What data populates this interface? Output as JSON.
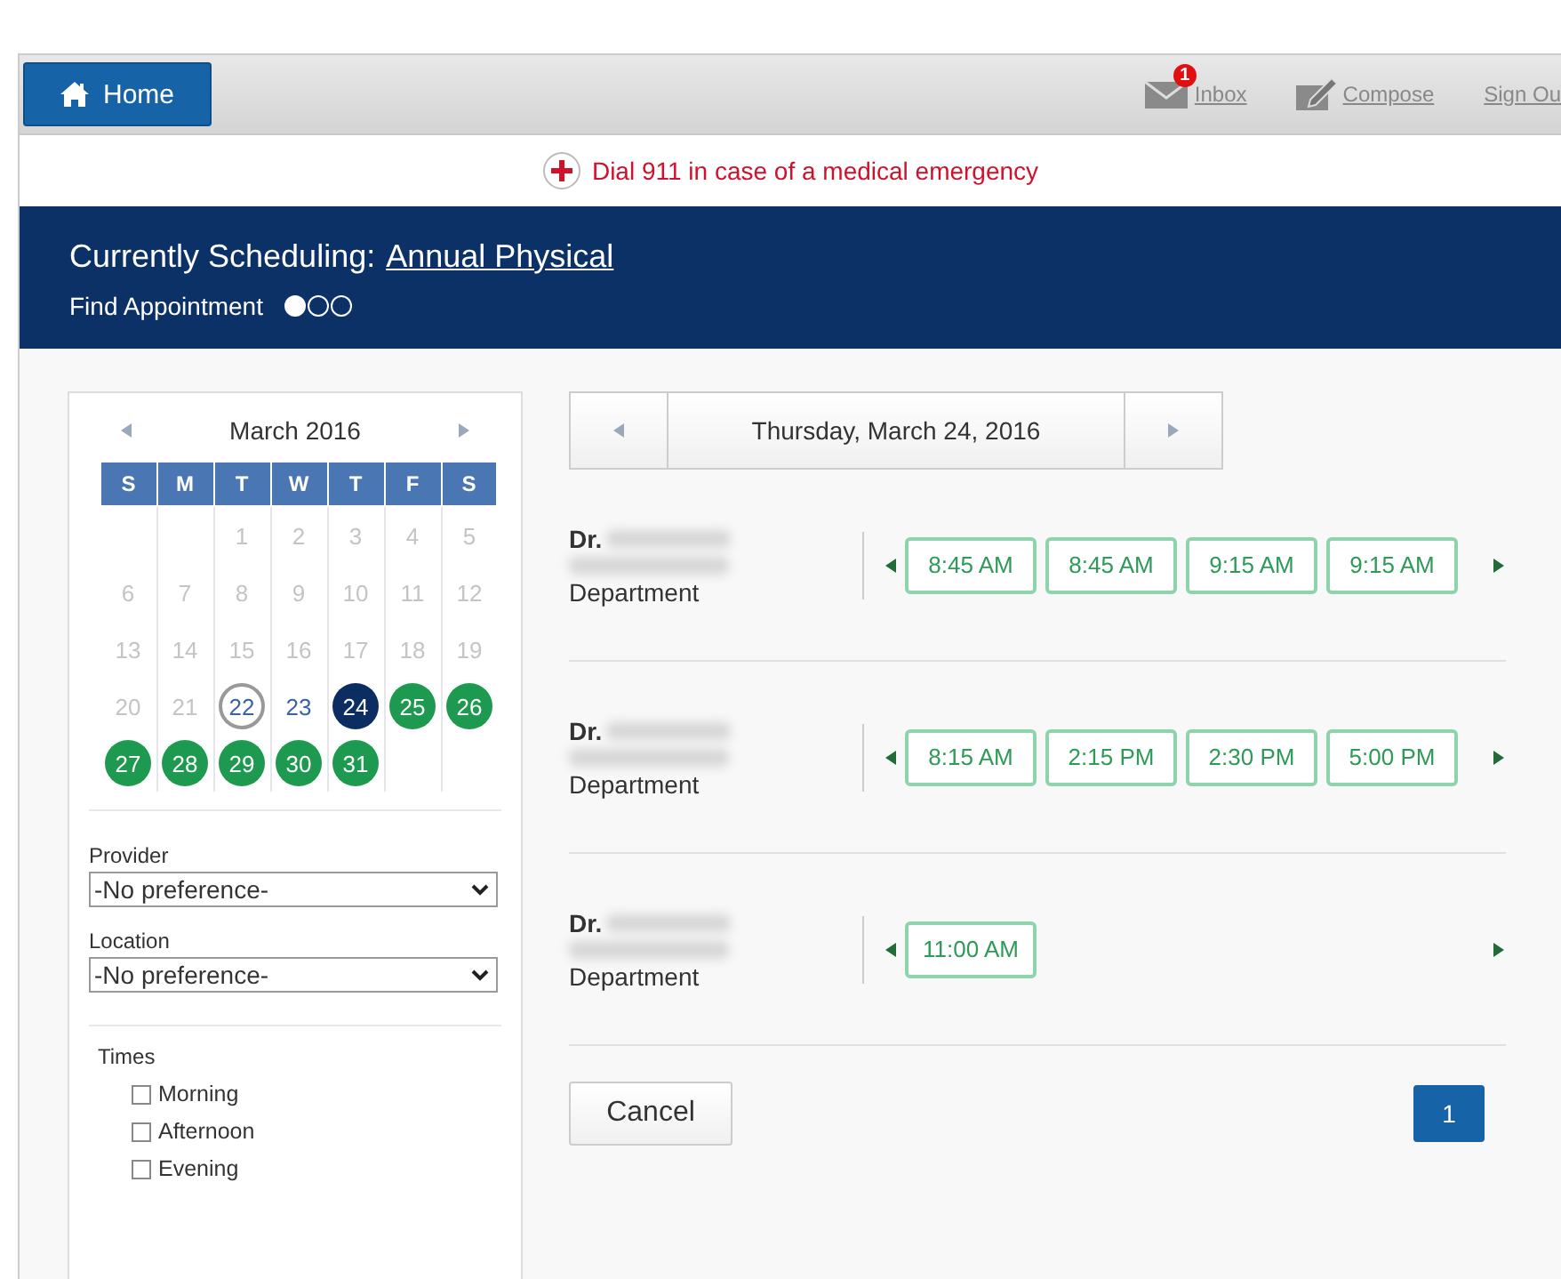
{
  "topbar": {
    "home": "Home",
    "inbox": {
      "label": "Inbox",
      "badge": "1"
    },
    "compose": "Compose",
    "sign_out": "Sign Ou"
  },
  "alert": "Dial 911 in case of a medical emergency",
  "banner": {
    "label": "Currently Scheduling:",
    "link": "Annual Physical",
    "step_label": "Find Appointment",
    "steps": [
      {
        "selected": true
      },
      {
        "selected": false
      },
      {
        "selected": false
      }
    ]
  },
  "calendar": {
    "month": "March 2016",
    "weekdays": [
      "S",
      "M",
      "T",
      "W",
      "T",
      "F",
      "S"
    ],
    "weeks": [
      [
        {
          "day": "1",
          "kind": "past"
        },
        {
          "day": "2",
          "kind": "past"
        },
        {
          "day": "3",
          "kind": "past"
        },
        {
          "day": "4",
          "kind": "past"
        },
        {
          "day": "5",
          "kind": "past"
        }
      ],
      [
        {
          "day": "6",
          "kind": "past"
        },
        {
          "day": "7",
          "kind": "past"
        },
        {
          "day": "8",
          "kind": "past"
        },
        {
          "day": "9",
          "kind": "past"
        },
        {
          "day": "10",
          "kind": "past"
        },
        {
          "day": "11",
          "kind": "past"
        },
        {
          "day": "12",
          "kind": "past"
        }
      ],
      [
        {
          "day": "13",
          "kind": "past"
        },
        {
          "day": "14",
          "kind": "past"
        },
        {
          "day": "15",
          "kind": "past"
        },
        {
          "day": "16",
          "kind": "past"
        },
        {
          "day": "17",
          "kind": "past"
        },
        {
          "day": "18",
          "kind": "past"
        },
        {
          "day": "19",
          "kind": "past"
        }
      ],
      [
        {
          "day": "20",
          "kind": "past"
        },
        {
          "day": "21",
          "kind": "past"
        },
        {
          "day": "22",
          "kind": "today"
        },
        {
          "day": "23",
          "kind": "plain"
        },
        {
          "day": "24",
          "kind": "selected"
        },
        {
          "day": "25",
          "kind": "open"
        },
        {
          "day": "26",
          "kind": "open"
        }
      ],
      [
        {
          "day": "27",
          "kind": "open"
        },
        {
          "day": "28",
          "kind": "open"
        },
        {
          "day": "29",
          "kind": "open"
        },
        {
          "day": "30",
          "kind": "open"
        },
        {
          "day": "31",
          "kind": "open"
        }
      ]
    ]
  },
  "filters": [
    {
      "label": "Provider",
      "value": "-No preference-"
    },
    {
      "label": "Location",
      "value": "-No preference-"
    }
  ],
  "times": {
    "label": "Times",
    "options": [
      {
        "label": "Morning",
        "checked": false
      },
      {
        "label": "Afternoon",
        "checked": false
      },
      {
        "label": "Evening",
        "checked": false
      }
    ]
  },
  "date_nav": {
    "date": "Thursday, March 24, 2016"
  },
  "providers": [
    {
      "title": "Dr.",
      "department": "Department",
      "slots": [
        "8:45 AM",
        "8:45 AM",
        "9:15 AM",
        "9:15 AM"
      ]
    },
    {
      "title": "Dr.",
      "department": "Department",
      "slots": [
        "8:15 AM",
        "2:15 PM",
        "2:30 PM",
        "5:00 PM"
      ]
    },
    {
      "title": "Dr.",
      "department": "Department",
      "slots": [
        "11:00 AM"
      ]
    }
  ],
  "cancel": "Cancel",
  "pages": [
    {
      "label": "1",
      "selected": true
    }
  ]
}
